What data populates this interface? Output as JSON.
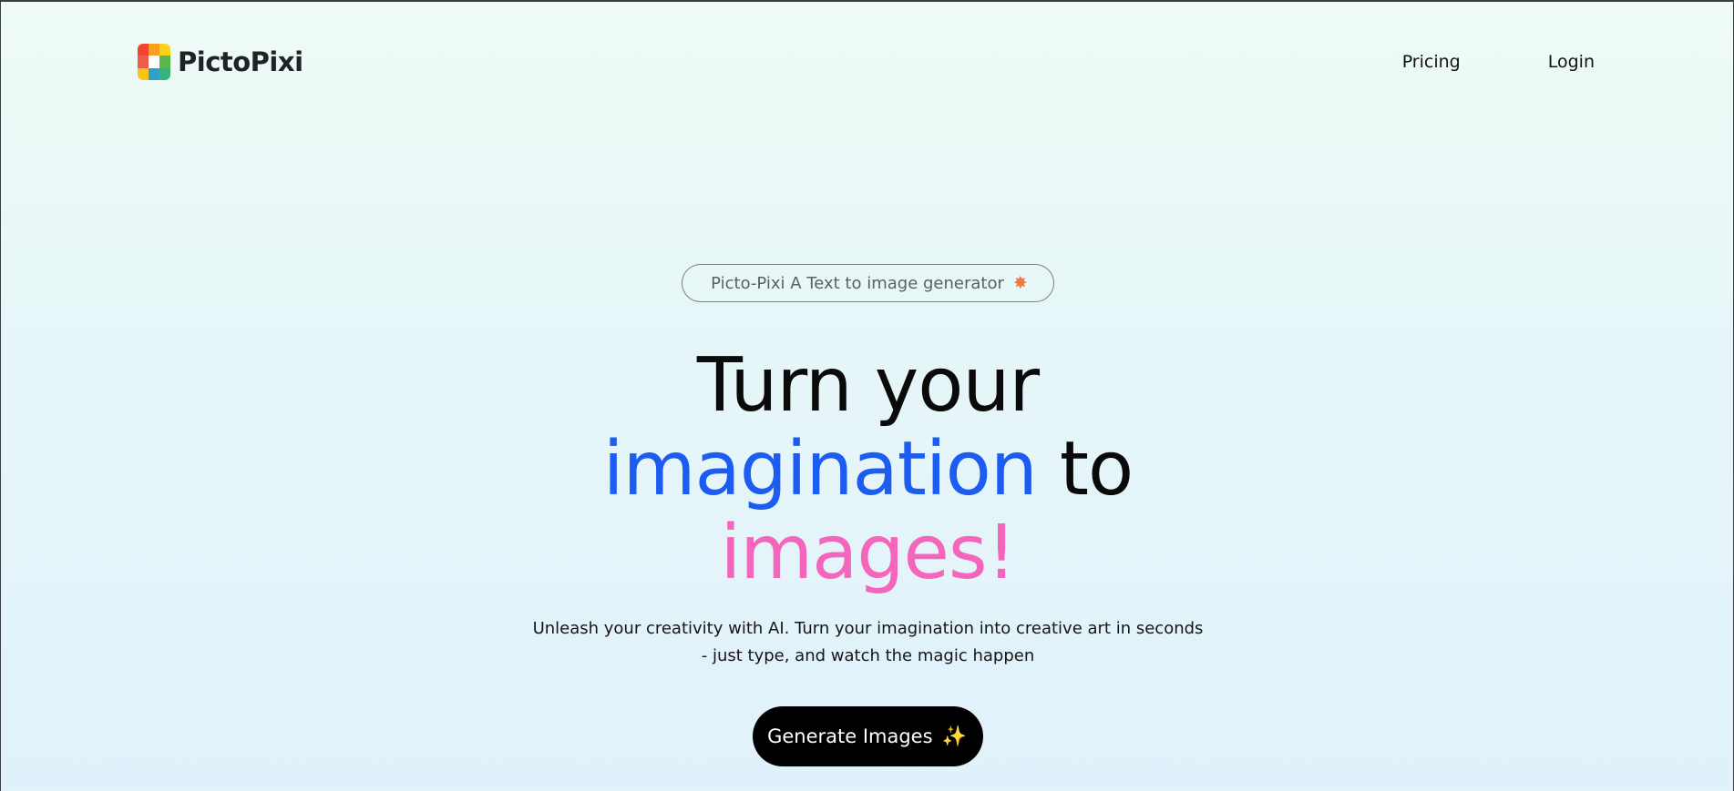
{
  "nav": {
    "brand": "PictoPixi",
    "logo_colors": [
      "#f4442f",
      "#f9a11b",
      "#fcd21c",
      "#ef5d4a",
      "#ffffff",
      "#5ab84b",
      "#f9c31e",
      "#2fa1c7",
      "#36b37e"
    ],
    "links": [
      "Pricing",
      "Login"
    ]
  },
  "hero": {
    "badge_text": "Picto-Pixi A Text to image generator",
    "badge_icon": "star-burst-icon",
    "headline": {
      "line1": "Turn your",
      "line2_highlight": "imagination",
      "line2_rest": " to",
      "line3": "images!"
    },
    "subtext_line1": "Unleash your creativity with AI. Turn your imagination into creative art in seconds",
    "subtext_line2": "- just type, and watch the magic happen",
    "cta_label": "Generate Images",
    "cta_icon": "sparkles-icon"
  },
  "colors": {
    "accent_blue": "#1c5cf0",
    "accent_pink": "#f366bb",
    "cta_background": "#000000"
  }
}
